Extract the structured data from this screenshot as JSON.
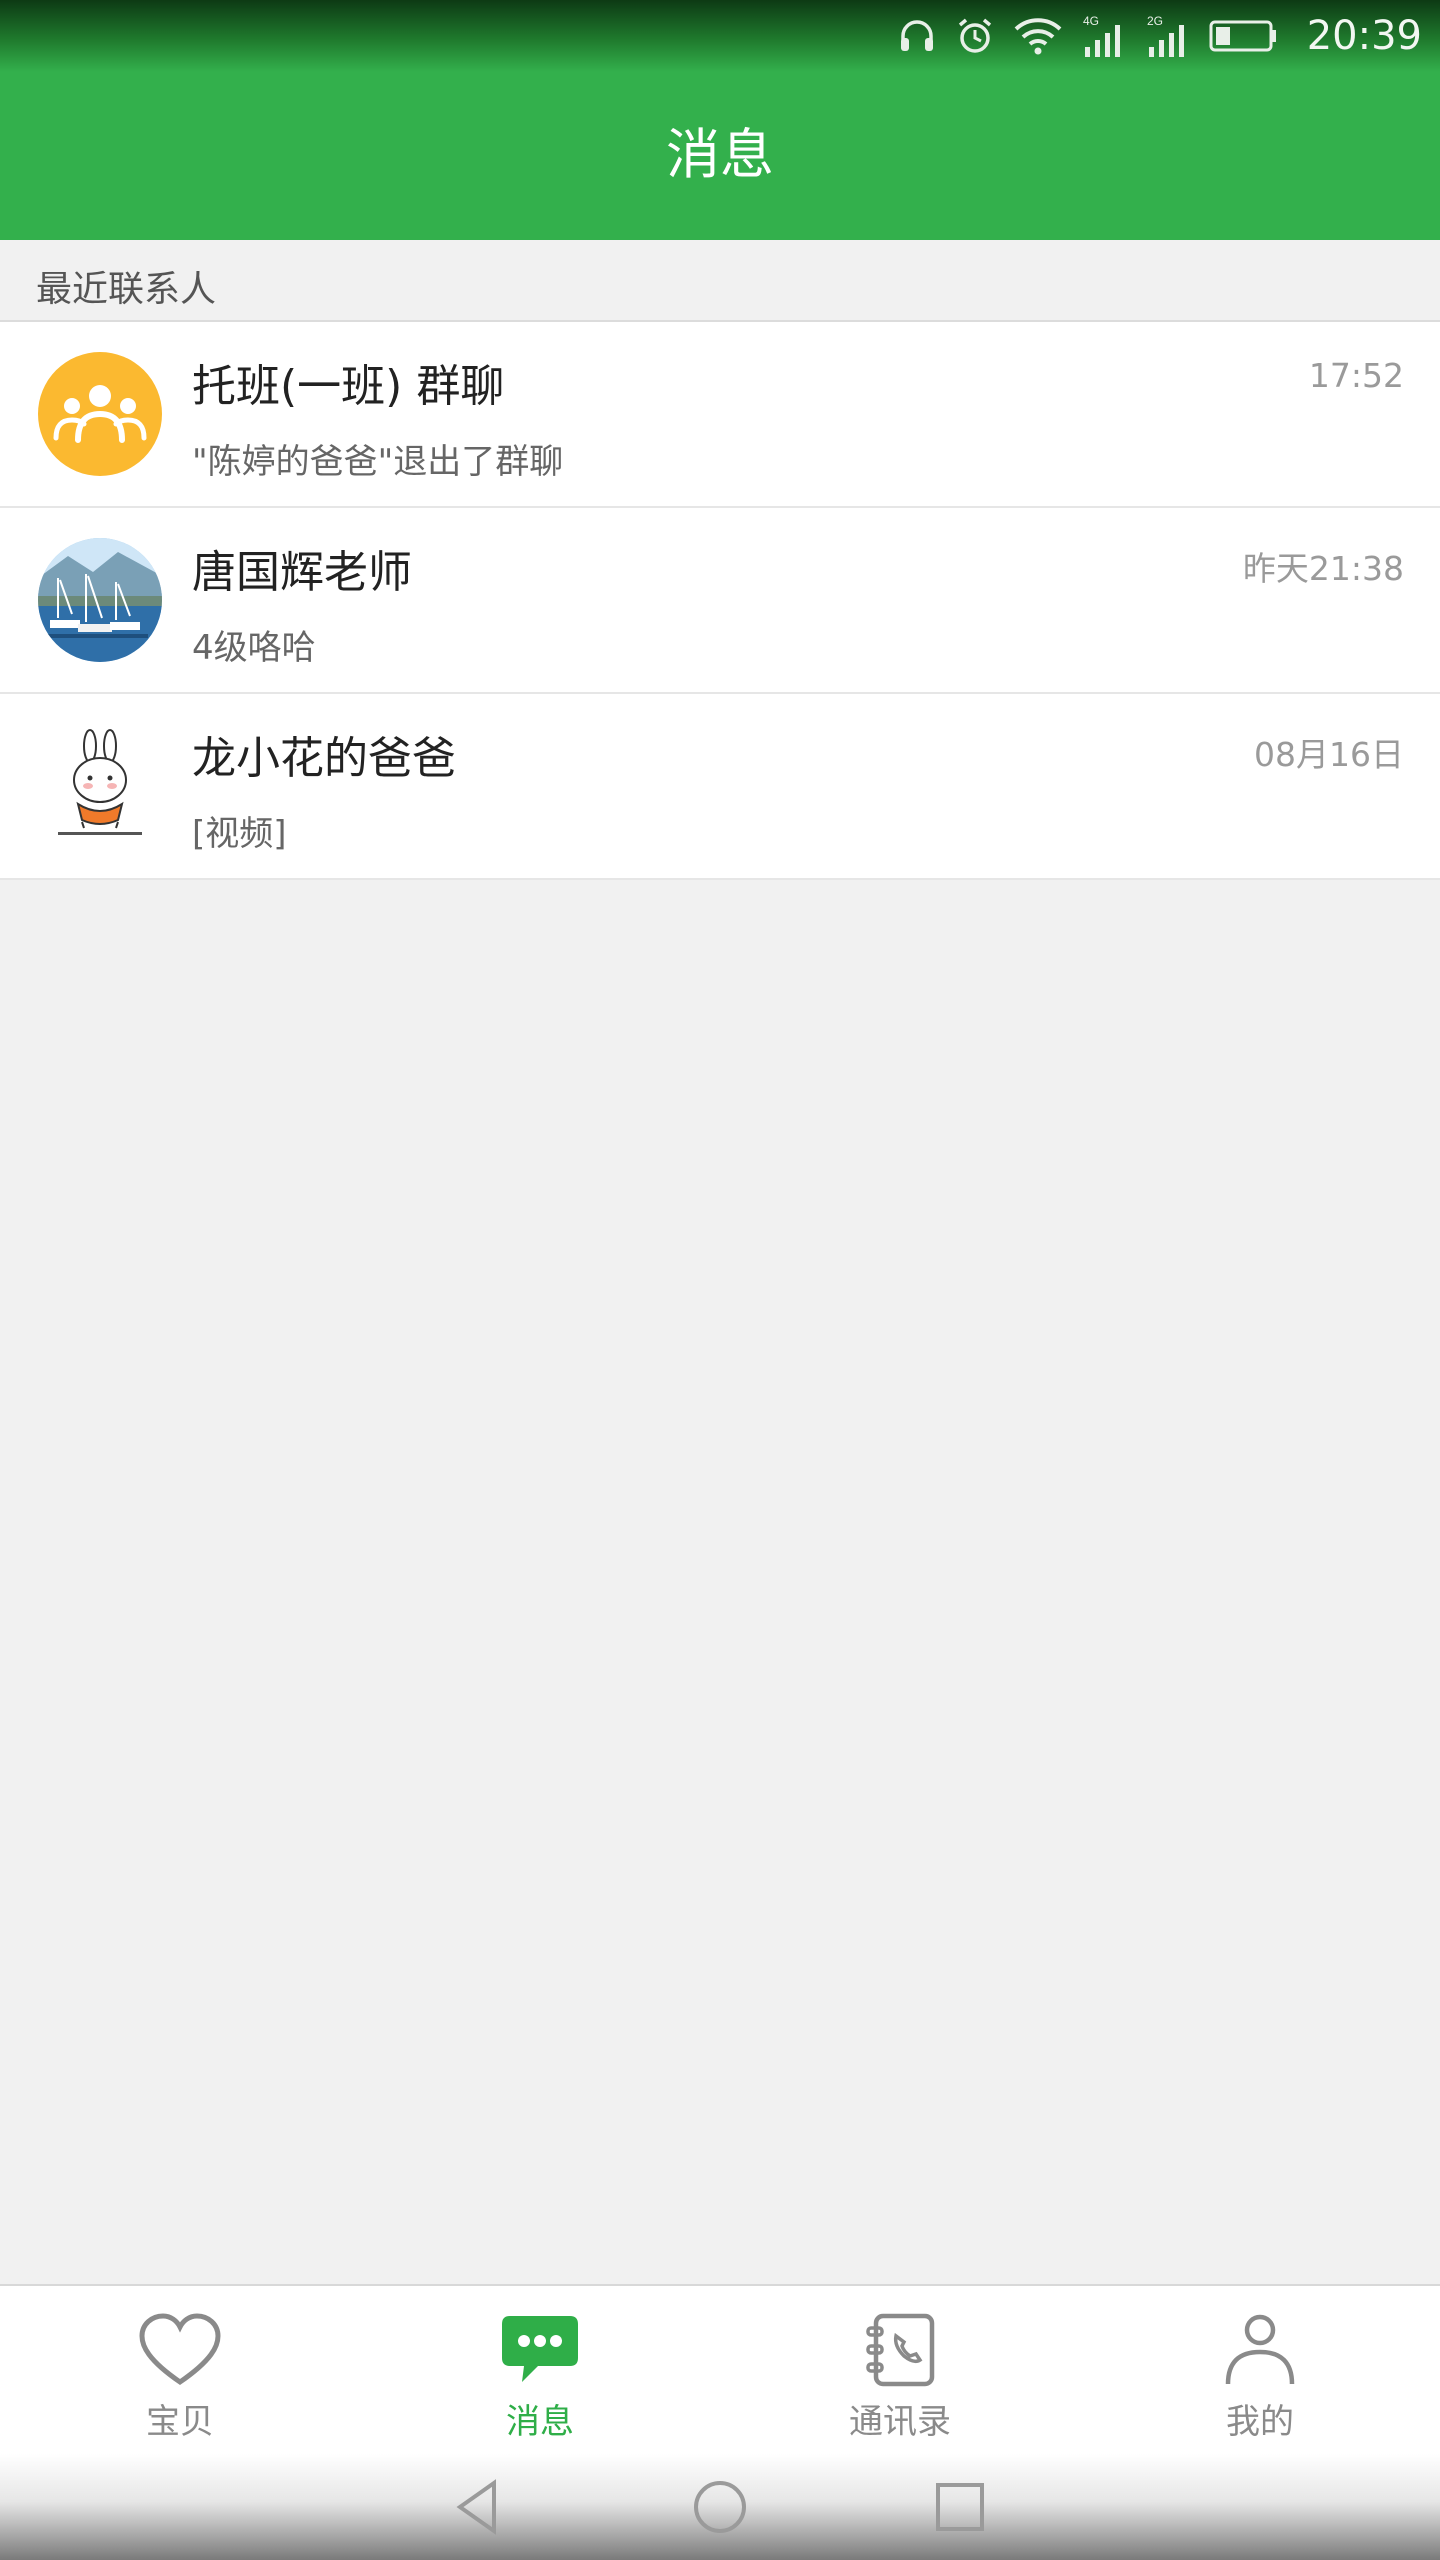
{
  "status_bar": {
    "time": "20:39",
    "network_4g": "4G",
    "network_2g": "2G",
    "icons": [
      "headphones-icon",
      "alarm-icon",
      "wifi-icon",
      "signal-4g-icon",
      "signal-2g-icon",
      "battery-icon"
    ]
  },
  "header": {
    "title": "消息"
  },
  "section": {
    "recent_contacts": "最近联系人"
  },
  "conversations": [
    {
      "name": "托班(一班) 群聊",
      "preview": "\"陈婷的爸爸\"退出了群聊",
      "time": "17:52",
      "avatar": "group-avatar-icon"
    },
    {
      "name": "唐国辉老师",
      "preview": "4级咯哈",
      "time": "昨天21:38",
      "avatar": "harbor-photo-avatar"
    },
    {
      "name": "龙小花的爸爸",
      "preview": "[视频]",
      "time": "08月16日",
      "avatar": "cartoon-rabbit-avatar"
    }
  ],
  "bottom_nav": {
    "items": [
      {
        "label": "宝贝",
        "icon": "heart-icon",
        "active": false
      },
      {
        "label": "消息",
        "icon": "chat-bubble-icon",
        "active": true
      },
      {
        "label": "通讯录",
        "icon": "contacts-book-icon",
        "active": false
      },
      {
        "label": "我的",
        "icon": "person-icon",
        "active": false
      }
    ]
  },
  "colors": {
    "brand_green": "#33b04c",
    "active_tab": "#2fae48",
    "group_avatar": "#fbb930"
  }
}
